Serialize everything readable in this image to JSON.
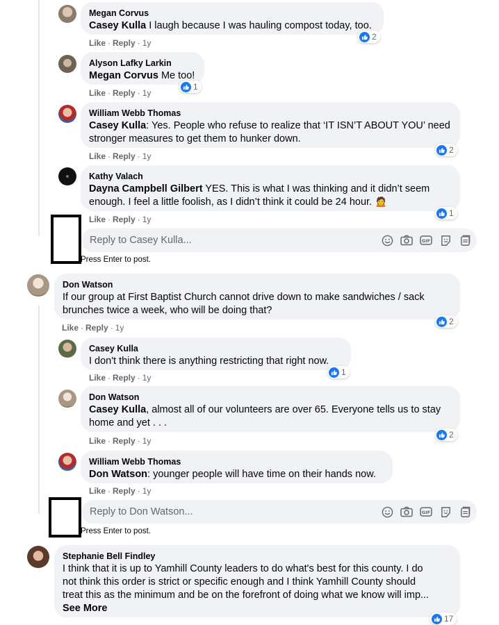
{
  "comments": [
    {
      "author": "Megan Corvus",
      "mention": "Casey Kulla",
      "text": " I laugh because I was hauling compost today, too.",
      "reactions": "2"
    },
    {
      "author": "Alyson Lafky Larkin",
      "mention": "Megan Corvus",
      "text": " Me too!",
      "reactions": "1"
    },
    {
      "author": "William Webb Thomas",
      "mention": "Casey Kulla",
      "text_line1": ": Yes. People who refuse to realize that ‘IT ISN’T ABOUT YOU’ need",
      "text_line2": "stronger measures to get them to hunker down.",
      "reactions": "2"
    },
    {
      "author": "Kathy Valach",
      "mention": "Dayna Campbell Gilbert",
      "text_line1": " YES. This is what I was thinking and it didn’t seem",
      "text_line2": "enough. I feel a little foolish, as I didn’t think it could be 24 hour.",
      "emoji": "🙍",
      "reactions": "1"
    },
    {
      "author": "Don Watson",
      "text_line1": "If our group at First Baptist Church cannot drive down to make sandwiches / sack",
      "text_line2": "brunches twice a week, who will be doing that?",
      "reactions": "2"
    },
    {
      "author": "Casey Kulla",
      "text": "I don't think there is anything restricting that right now.",
      "reactions": "1"
    },
    {
      "author": "Don Watson",
      "mention": "Casey Kulla",
      "text_line1": ", almost all of our volunteers are over 65. Everyone tells us to stay",
      "text_line2": "home and yet . . .",
      "reactions": "2"
    },
    {
      "author": "William Webb Thomas",
      "mention": "Don Watson",
      "text": ": younger people will have time on their hands now."
    },
    {
      "author": "Stephanie Bell Findley",
      "text_line1": "I think that it is up to Yamhill County leaders to do what's best for this county. I do",
      "text_line2": "not think this order is strict or specific enough and I think Yamhill County should",
      "text_line3": "treat this as the minimum and be on the forefront of doing what we know will imp...",
      "see_more": "See More",
      "reactions": "17"
    }
  ],
  "actions": {
    "like": "Like",
    "reply": "Reply",
    "dot": "·",
    "time": "1y"
  },
  "reply_boxes": [
    {
      "placeholder": "Reply to Casey Kulla...",
      "hint": "Press Enter to post."
    },
    {
      "placeholder": "Reply to Don Watson...",
      "hint": "Press Enter to post."
    }
  ],
  "colors": {
    "bubble": "#f0f2f5",
    "like_blue": "#1877f2",
    "meta_gray": "#65676b"
  },
  "icons": [
    "like-icon",
    "emoji-icon",
    "camera-icon",
    "gif-icon",
    "sticker-icon",
    "avatar-sticker-icon"
  ]
}
